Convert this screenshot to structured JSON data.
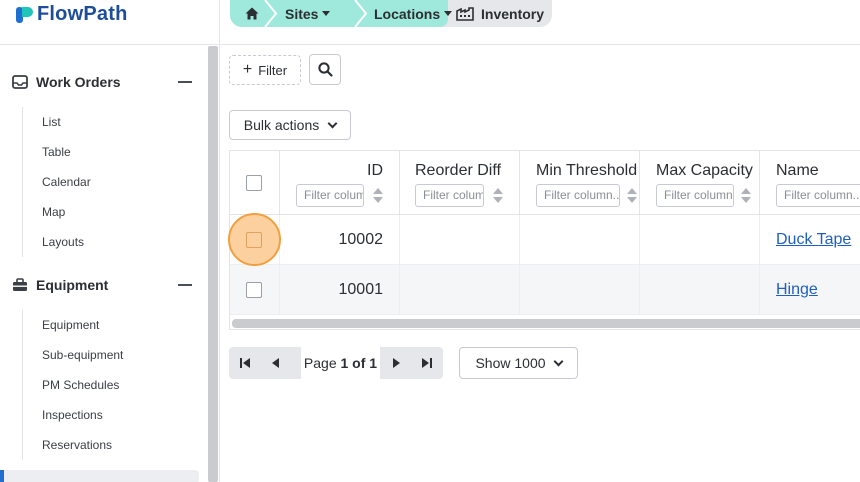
{
  "app": {
    "name": "FlowPath"
  },
  "breadcrumb": {
    "items": [
      {
        "label": "Sites",
        "dropdown": true
      },
      {
        "label": "Locations",
        "dropdown": true
      },
      {
        "label": "Inventory",
        "dropdown": false
      }
    ]
  },
  "sidebar": {
    "sections": [
      {
        "label": "Work Orders",
        "icon": "inbox-tray-icon",
        "items": [
          "List",
          "Table",
          "Calendar",
          "Map",
          "Layouts"
        ]
      },
      {
        "label": "Equipment",
        "icon": "toolbox-icon",
        "items": [
          "Equipment",
          "Sub-equipment",
          "PM Schedules",
          "Inspections",
          "Reservations"
        ]
      }
    ]
  },
  "toolbar": {
    "filter_label": "Filter",
    "bulk_label": "Bulk actions"
  },
  "table": {
    "columns": [
      {
        "label": "ID",
        "filter_placeholder": "Filter column..."
      },
      {
        "label": "Reorder Diff",
        "filter_placeholder": "Filter column..."
      },
      {
        "label": "Min Threshold",
        "filter_placeholder": "Filter column..."
      },
      {
        "label": "Max Capacity",
        "filter_placeholder": "Filter column..."
      },
      {
        "label": "Name",
        "filter_placeholder": "Filter column..."
      }
    ],
    "rows": [
      {
        "id": "10002",
        "reorder_diff": "",
        "min_threshold": "",
        "max_capacity": "",
        "name": "Duck Tape"
      },
      {
        "id": "10001",
        "reorder_diff": "",
        "min_threshold": "",
        "max_capacity": "",
        "name": "Hinge"
      }
    ]
  },
  "pagination": {
    "prefix": "Page",
    "current": "1 of 1",
    "show_label": "Show 1000"
  },
  "colors": {
    "brand": "#1e4e9a",
    "accent_teal": "#9ee8dc",
    "link": "#1f5fbf",
    "click_highlight": "#f0a040"
  }
}
